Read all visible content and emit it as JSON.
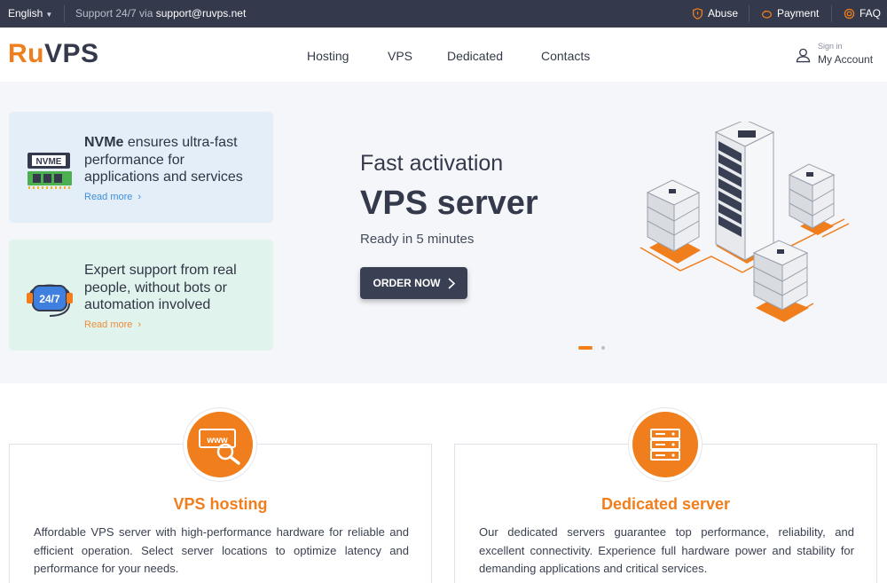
{
  "topbar": {
    "language": "English",
    "support_prefix": "Support 24/7 via",
    "support_email": "support@ruvps.net",
    "links": {
      "abuse": "Abuse",
      "payment": "Payment",
      "faq": "FAQ"
    }
  },
  "header": {
    "logo_ru": "Ru",
    "logo_vps": "VPS",
    "nav": [
      "Hosting",
      "VPS",
      "Dedicated",
      "Contacts"
    ],
    "account": {
      "sign_in": "Sign in",
      "label": "My Account"
    }
  },
  "hero": {
    "cards": [
      {
        "bold": "NVMe",
        "text": " ensures ultra-fast performance for applications and services",
        "read_more": "Read more",
        "icon": "nvme-icon"
      },
      {
        "text": "Expert support from real people, without bots or automation involved",
        "read_more": "Read more",
        "icon": "support-24-7-icon"
      }
    ],
    "subtitle": "Fast activation",
    "title": "VPS server",
    "description": "Ready in 5 minutes",
    "cta": "ORDER NOW",
    "slider": {
      "active": 1,
      "total": 2
    }
  },
  "services": [
    {
      "title": "VPS hosting",
      "icon": "www-search-icon",
      "text": "Affordable VPS server with high-performance hardware for reliable and efficient operation. Select server locations to optimize latency and performance for your needs."
    },
    {
      "title": "Dedicated server",
      "icon": "server-rack-icon",
      "text": "Our dedicated servers guarantee top performance, reliability, and excellent connectivity. Experience full hardware power and stability for demanding applications and critical services."
    }
  ],
  "colors": {
    "accent": "#f07e1c",
    "dark": "#343a4b",
    "blue_link": "#3e8ed8"
  }
}
